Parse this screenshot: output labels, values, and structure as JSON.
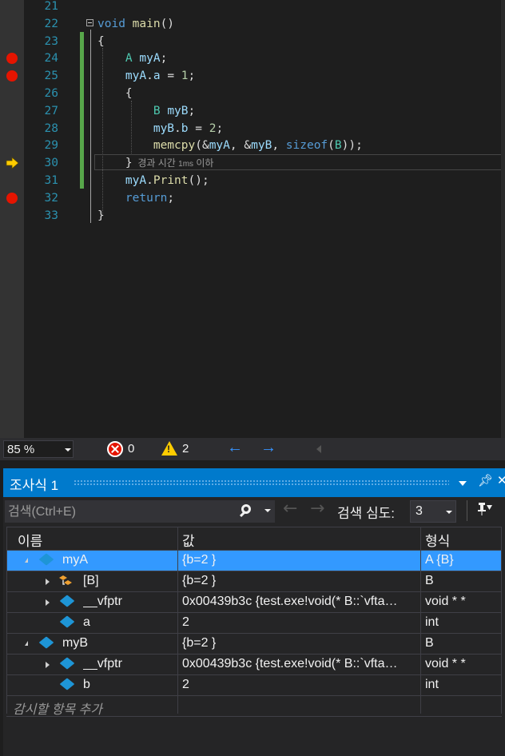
{
  "editor": {
    "lines": [
      {
        "num": "21",
        "tokens": []
      },
      {
        "num": "22",
        "tokens": [
          {
            "t": "void ",
            "c": "kw"
          },
          {
            "t": "main",
            "c": "fn"
          },
          {
            "t": "()",
            "c": "pn"
          }
        ]
      },
      {
        "num": "23",
        "tokens": [
          {
            "t": "{",
            "c": "pn"
          }
        ]
      },
      {
        "num": "24",
        "tokens": [
          {
            "t": "    ",
            "c": "pn"
          },
          {
            "t": "A ",
            "c": "ty"
          },
          {
            "t": "myA",
            "c": "vr"
          },
          {
            "t": ";",
            "c": "pn"
          }
        ]
      },
      {
        "num": "25",
        "tokens": [
          {
            "t": "    ",
            "c": "pn"
          },
          {
            "t": "myA",
            "c": "vr"
          },
          {
            "t": ".",
            "c": "pn"
          },
          {
            "t": "a",
            "c": "vr"
          },
          {
            "t": " = ",
            "c": "pn"
          },
          {
            "t": "1",
            "c": "nm"
          },
          {
            "t": ";",
            "c": "pn"
          }
        ]
      },
      {
        "num": "26",
        "tokens": [
          {
            "t": "    {",
            "c": "pn"
          }
        ]
      },
      {
        "num": "27",
        "tokens": [
          {
            "t": "        ",
            "c": "pn"
          },
          {
            "t": "B ",
            "c": "ty"
          },
          {
            "t": "myB",
            "c": "vr"
          },
          {
            "t": ";",
            "c": "pn"
          }
        ]
      },
      {
        "num": "28",
        "tokens": [
          {
            "t": "        ",
            "c": "pn"
          },
          {
            "t": "myB",
            "c": "vr"
          },
          {
            "t": ".",
            "c": "pn"
          },
          {
            "t": "b",
            "c": "vr"
          },
          {
            "t": " = ",
            "c": "pn"
          },
          {
            "t": "2",
            "c": "nm"
          },
          {
            "t": ";",
            "c": "pn"
          }
        ]
      },
      {
        "num": "29",
        "tokens": [
          {
            "t": "        ",
            "c": "pn"
          },
          {
            "t": "memcpy",
            "c": "fn"
          },
          {
            "t": "(&",
            "c": "pn"
          },
          {
            "t": "myA",
            "c": "vr"
          },
          {
            "t": ", &",
            "c": "pn"
          },
          {
            "t": "myB",
            "c": "vr"
          },
          {
            "t": ", ",
            "c": "pn"
          },
          {
            "t": "sizeof",
            "c": "kw"
          },
          {
            "t": "(",
            "c": "pn"
          },
          {
            "t": "B",
            "c": "ty"
          },
          {
            "t": "));",
            "c": "pn"
          }
        ]
      },
      {
        "num": "30",
        "tokens": [
          {
            "t": "    }",
            "c": "pn"
          }
        ]
      },
      {
        "num": "31",
        "tokens": [
          {
            "t": "    ",
            "c": "pn"
          },
          {
            "t": "myA",
            "c": "vr"
          },
          {
            "t": ".",
            "c": "pn"
          },
          {
            "t": "Print",
            "c": "fn"
          },
          {
            "t": "();",
            "c": "pn"
          }
        ]
      },
      {
        "num": "32",
        "tokens": [
          {
            "t": "    ",
            "c": "kw"
          },
          {
            "t": "return",
            "c": "kw"
          },
          {
            "t": ";",
            "c": "pn"
          }
        ]
      },
      {
        "num": "33",
        "tokens": [
          {
            "t": "}",
            "c": "pn"
          }
        ]
      }
    ],
    "breakpoint_lines": [
      "24",
      "25",
      "32"
    ],
    "current_line": "30",
    "perf_tip": {
      "prefix": "경과 시간",
      "ms": "1ms",
      "suffix": "이하"
    }
  },
  "status_bar": {
    "zoom": "85 %",
    "errors": "0",
    "warnings": "2"
  },
  "watch": {
    "title": "조사식 1",
    "search_placeholder": "검색(Ctrl+E)",
    "depth_label": "검색 심도:",
    "depth_value": "3",
    "columns": {
      "name": "이름",
      "value": "값",
      "type": "형식"
    },
    "rows": [
      {
        "name": "myA",
        "value": "{b=2 }",
        "type": "A {B}",
        "level": 0,
        "expander": "open",
        "icon": "field-cube-icon",
        "selected": true
      },
      {
        "name": "[B]",
        "value": "{b=2 }",
        "type": "B",
        "level": 1,
        "expander": "closed",
        "icon": "base-class-icon",
        "selected": false
      },
      {
        "name": "__vfptr",
        "value": "0x00439b3c {test.exe!void(* B::`vfta…",
        "type": "void * *",
        "level": 1,
        "expander": "closed",
        "icon": "field-cube-icon",
        "selected": false
      },
      {
        "name": "a",
        "value": "2",
        "type": "int",
        "level": 1,
        "expander": "none",
        "icon": "field-cube-icon",
        "selected": false
      },
      {
        "name": "myB",
        "value": "{b=2 }",
        "type": "B",
        "level": 0,
        "expander": "open",
        "icon": "field-cube-icon",
        "selected": false
      },
      {
        "name": "__vfptr",
        "value": "0x00439b3c {test.exe!void(* B::`vfta…",
        "type": "void * *",
        "level": 1,
        "expander": "closed",
        "icon": "field-cube-icon",
        "selected": false
      },
      {
        "name": "b",
        "value": "2",
        "type": "int",
        "level": 1,
        "expander": "none",
        "icon": "field-cube-icon",
        "selected": false
      }
    ],
    "add_item_placeholder": "감시할 항목 추가"
  },
  "colors": {
    "editor_bg": "#1e1e1e",
    "breakpoint": "#e51400",
    "accent": "#007acc",
    "selection": "#3399ff",
    "change_bar": "#57a64a"
  }
}
